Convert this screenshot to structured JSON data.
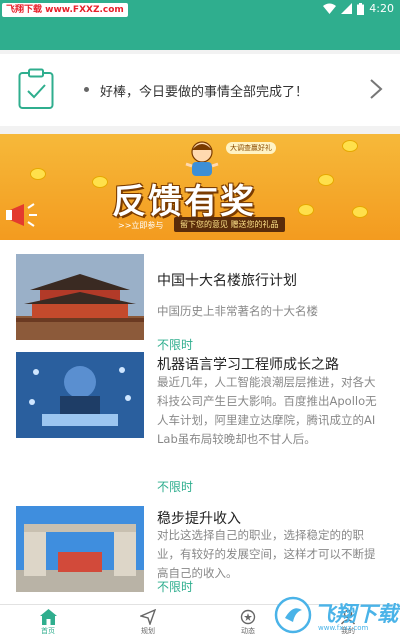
{
  "status_bar": {
    "watermark_badge": "飞翔下载 www.FXXZ.com",
    "time": "4:20",
    "icons": [
      "wifi-icon",
      "signal-icon",
      "battery-icon"
    ]
  },
  "task_card": {
    "text": "好棒，今日要做的事情全部完成了！",
    "icon": "clipboard-check-icon",
    "chevron": "chevron-right-icon"
  },
  "banner": {
    "title": "反馈有奖",
    "subtitle": "留下您的意见  赠送您的礼品",
    "join": ">>立即参与",
    "small_badge": "大调查赢好礼"
  },
  "articles": [
    {
      "title": "中国十大名楼旅行计划",
      "desc": "中国历史上非常著名的十大名楼",
      "tag": "不限时"
    },
    {
      "title": "机器语言学习工程师成长之路",
      "desc": "最近几年，人工智能浪潮层层推进，对各大科技公司产生巨大影响。百度推出Apollo无人车计划，阿里建立达摩院，腾讯成立的AI Lab虽布局较晚却也不甘人后。",
      "tag": "不限时"
    },
    {
      "title": "稳步提升收入",
      "desc": "对比这选择自己的职业，选择稳定的的职业，有较好的发展空间，这样才可以不断提高自己的收入。",
      "tag": "不限时"
    }
  ],
  "tabs": [
    {
      "label": "首页",
      "icon": "home-icon",
      "active": true
    },
    {
      "label": "规划",
      "icon": "send-icon",
      "active": false
    },
    {
      "label": "动态",
      "icon": "moments-icon",
      "active": false
    },
    {
      "label": "我的",
      "icon": "profile-icon",
      "active": false
    }
  ],
  "watermark": {
    "text": "飞翔下载",
    "url": "www.fxxz.com"
  },
  "colors": {
    "accent": "#2fae8e",
    "banner": "#f39b1f"
  }
}
